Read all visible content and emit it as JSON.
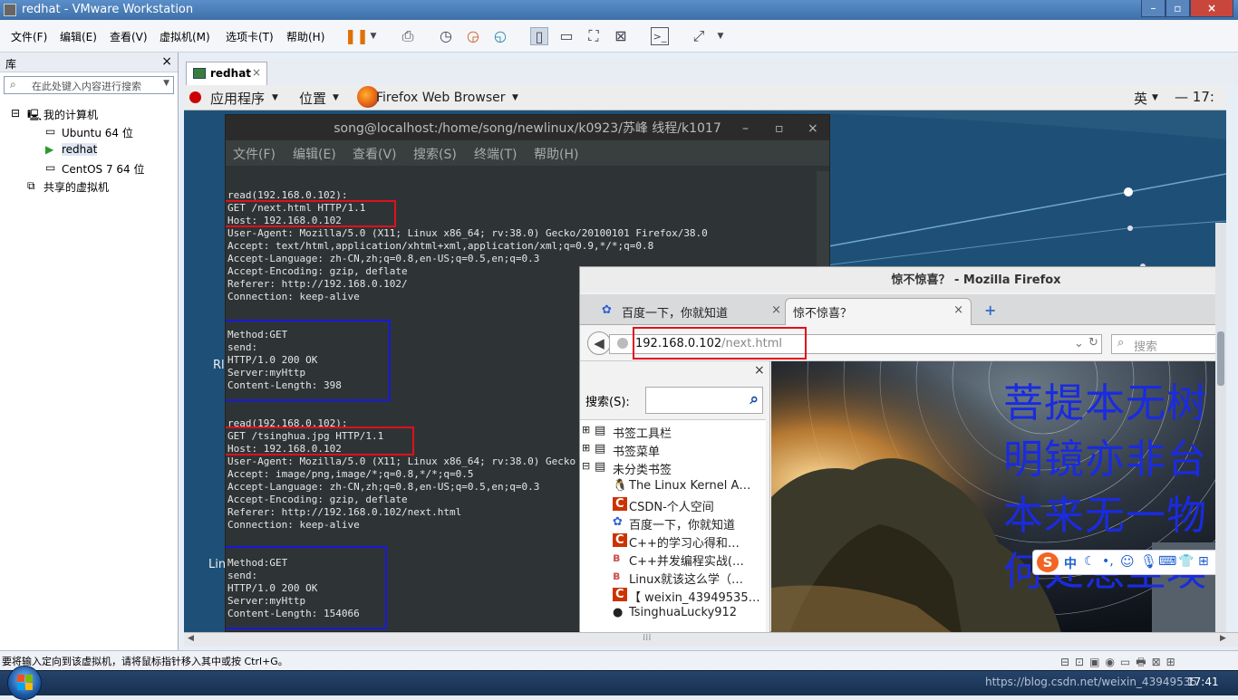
{
  "vmware": {
    "title": "redhat - VMware Workstation",
    "menu": [
      "文件(F)",
      "编辑(E)",
      "查看(V)",
      "虚拟机(M)",
      "选项卡(T)",
      "帮助(H)"
    ]
  },
  "library": {
    "header": "库",
    "close": "×",
    "search_placeholder": "在此处键入内容进行搜索",
    "tree": {
      "root": "我的计算机",
      "vms": [
        "Ubuntu 64 位",
        "redhat",
        "CentOS 7 64 位"
      ],
      "shared": "共享的虚拟机"
    }
  },
  "tab": {
    "label": "redhat",
    "close": "×"
  },
  "gnome": {
    "apps": "应用程序",
    "places": "位置",
    "browser": "Firefox Web Browser",
    "lang": "英",
    "clock": "17:"
  },
  "desktop": {
    "frag1": "Rl",
    "frag2": "Lin"
  },
  "terminal": {
    "title": "song@localhost:/home/song/newlinux/k0923/苏峰 线程/k1017",
    "win_buttons": [
      "–",
      "▫",
      "×"
    ],
    "menu": [
      "文件(F)",
      "编辑(E)",
      "查看(V)",
      "搜索(S)",
      "终端(T)",
      "帮助(H)"
    ],
    "lines": [
      "read(192.168.0.102):",
      "GET /next.html HTTP/1.1",
      "Host: 192.168.0.102",
      "User-Agent: Mozilla/5.0 (X11; Linux x86_64; rv:38.0) Gecko/20100101 Firefox/38.0",
      "Accept: text/html,application/xhtml+xml,application/xml;q=0.9,*/*;q=0.8",
      "Accept-Language: zh-CN,zh;q=0.8,en-US;q=0.5,en;q=0.3",
      "Accept-Encoding: gzip, deflate",
      "Referer: http://192.168.0.102/",
      "Connection: keep-alive",
      "",
      "Method:GET",
      "send:",
      "HTTP/1.0 200 OK",
      "Server:myHttp",
      "Content-Length: 398",
      "",
      "read(192.168.0.102):",
      "GET /tsinghua.jpg HTTP/1.1",
      "Host: 192.168.0.102",
      "User-Agent: Mozilla/5.0 (X11; Linux x86_64; rv:38.0) Gecko",
      "Accept: image/png,image/*;q=0.8,*/*;q=0.5",
      "Accept-Language: zh-CN,zh;q=0.8,en-US;q=0.5,en;q=0.3",
      "Accept-Encoding: gzip, deflate",
      "Referer: http://192.168.0.102/next.html",
      "Connection: keep-alive",
      "",
      "Method:GET",
      "send:",
      "HTTP/1.0 200 OK",
      "Server:myHttp",
      "Content-Length: 154066"
    ]
  },
  "firefox": {
    "title": "惊不惊喜？  - Mozilla Firefox",
    "tabs": [
      "百度一下，你就知道",
      "惊不惊喜？"
    ],
    "tab_close": "×",
    "new_tab": "+",
    "url_host": "192.168.0.102",
    "url_path": "/next.html",
    "search_placeholder": "搜索",
    "sidebar_close": "×",
    "sidebar_search_label": "搜索(S):",
    "bookmark_groups": [
      "书签工具栏",
      "书签菜单",
      "未分类书签"
    ],
    "bookmarks": [
      "The Linux Kernel A…",
      "CSDN-个人空间",
      "百度一下，你就知道",
      "C++的学习心得和…",
      "C++并发编程实战(…",
      "Linux就该这么学（…",
      "【 weixin_43949535…",
      "TsinghuaLucky912"
    ],
    "poem": [
      "菩提本无树",
      "明镜亦非台",
      "本来无一物",
      "何处惹尘埃"
    ],
    "ime_text": "中"
  },
  "status": {
    "message": "要将输入定向到该虚拟机，请将鼠标指针移入其中或按 Ctrl+G。",
    "watermark": "https://blog.csdn.net/weixin_43949535",
    "time": "17:41"
  }
}
